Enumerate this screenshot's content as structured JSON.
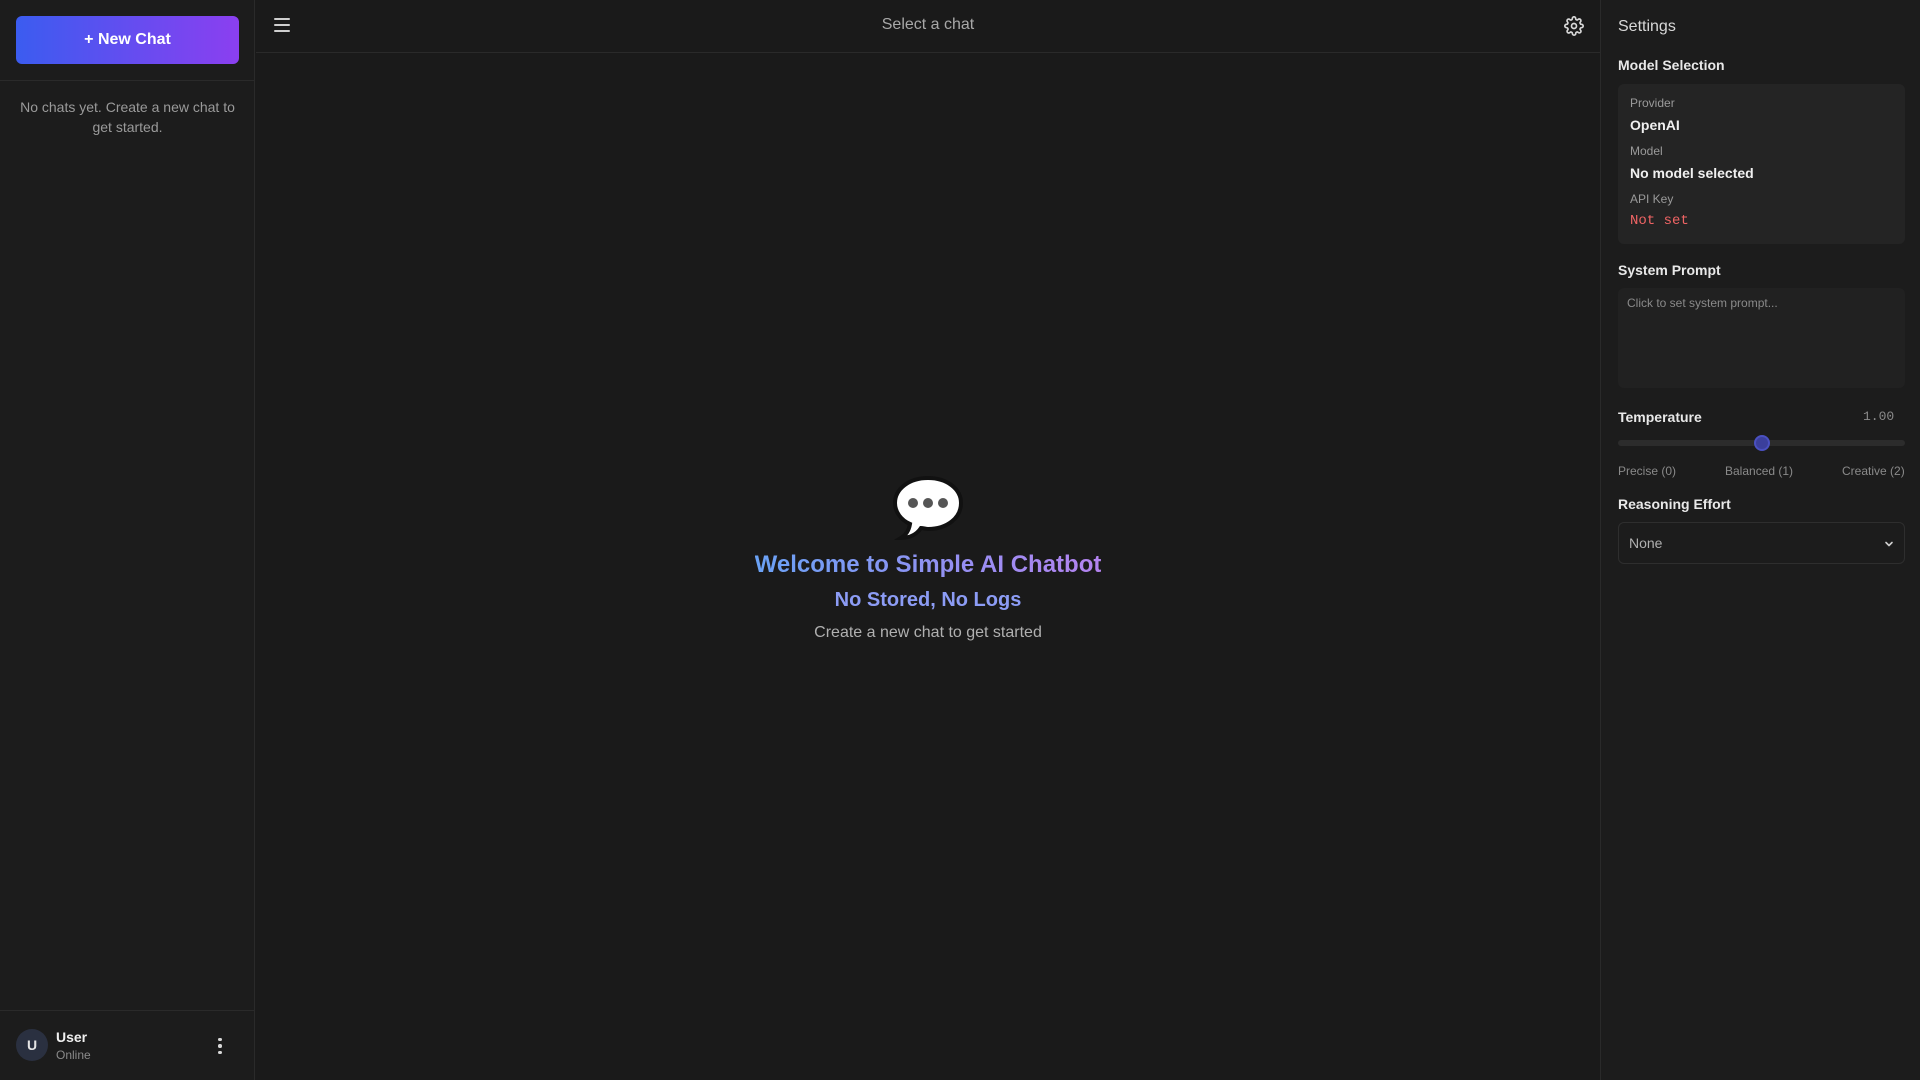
{
  "sidebar": {
    "new_chat_label": "+ New Chat",
    "empty_message": "No chats yet. Create a new chat to get started.",
    "user": {
      "initial": "U",
      "name": "User",
      "status": "Online"
    }
  },
  "header": {
    "title": "Select a chat",
    "icons": [
      "menu-icon",
      "gear-icon"
    ]
  },
  "welcome": {
    "icon": "speech-bubble-icon",
    "title": "Welcome to Simple AI Chatbot",
    "subtitle": "No Stored, No Logs",
    "hint": "Create a new chat to get started"
  },
  "settings": {
    "title": "Settings",
    "model_selection": {
      "label": "Model Selection",
      "provider_label": "Provider",
      "provider_value": "OpenAI",
      "model_label": "Model",
      "model_value": "No model selected",
      "api_key_label": "API Key",
      "api_key_value": "Not set"
    },
    "system_prompt": {
      "label": "System Prompt",
      "placeholder": "Click to set system prompt..."
    },
    "temperature": {
      "label": "Temperature",
      "value_text": "1.00",
      "value": 1.0,
      "min": 0,
      "max": 2,
      "ticks": [
        "Precise (0)",
        "Balanced (1)",
        "Creative (2)"
      ]
    },
    "reasoning_effort": {
      "label": "Reasoning Effort",
      "selected": "None"
    }
  },
  "colors": {
    "background": "#1a1a1a",
    "accent_start": "#3b5cf0",
    "accent_end": "#8b3ff0",
    "api_key_warning": "#f06464"
  }
}
